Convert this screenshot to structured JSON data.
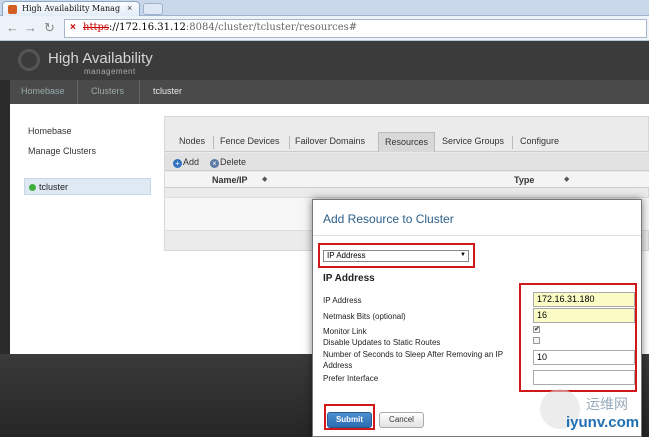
{
  "browser": {
    "tab_title": "High Availability Manag",
    "tab_close": "×",
    "back_symbol": "←",
    "forward_symbol": "→",
    "refresh_symbol": "↻",
    "url_icon": "×",
    "url_scheme": "https",
    "url_host": "://172.16.31.12",
    "url_rest": ":8084/cluster/tcluster/resources#"
  },
  "header": {
    "brand": "High Availability",
    "brand_sub": "management"
  },
  "breadcrumb": [
    "Homebase",
    "Clusters",
    "tcluster"
  ],
  "sidebar": {
    "items": [
      "Homebase",
      "Manage Clusters"
    ],
    "cluster": "tcluster",
    "cluster_status_color": "#3fae3c"
  },
  "tabs": [
    "Nodes",
    "Fence Devices",
    "Failover Domains",
    "Resources",
    "Service Groups",
    "Configure"
  ],
  "active_tab": "Resources",
  "actions": {
    "add": "Add",
    "add_icon": "+",
    "delete": "Delete",
    "delete_icon": "×"
  },
  "table": {
    "columns": [
      "Name/IP",
      "Type"
    ],
    "sort_icon": "◆"
  },
  "modal": {
    "title": "Add Resource to Cluster",
    "resource_type": "IP Address",
    "select_arrow": "▼",
    "section": "IP Address",
    "fields": {
      "ip_label": "IP Address",
      "ip_value": "172.16.31.180",
      "netmask_label": "Netmask Bits (optional)",
      "netmask_value": "16",
      "monitor_label": "Monitor Link",
      "monitor_checked": "✔",
      "disable_label": "Disable Updates to Static Routes",
      "sleep_label": "Number of Seconds to Sleep After Removing an IP Address",
      "sleep_value": "10",
      "prefer_label": "Prefer Interface",
      "prefer_value": ""
    },
    "submit": "Submit",
    "cancel": "Cancel"
  },
  "watermark": {
    "line1": "运维网",
    "line2": "iyunv.com"
  },
  "colors": {
    "highlight": "#d01818",
    "link_title": "#2d5f8a",
    "field_highlight": "#fbfbc5"
  }
}
